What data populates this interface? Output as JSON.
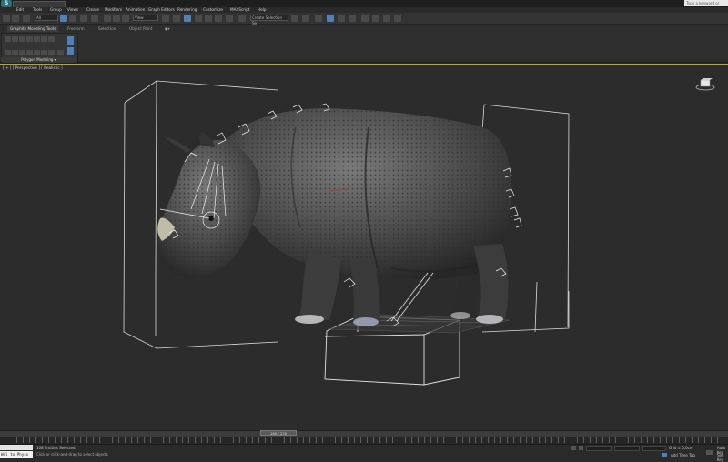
{
  "titlebar": {
    "logo": "S",
    "search_placeholder": "Type a keyword or phrase"
  },
  "menu": {
    "items": [
      "Edit",
      "Tools",
      "Group",
      "Views",
      "Create",
      "Modifiers",
      "Animation",
      "Graph Editors",
      "Rendering",
      "Customize",
      "MAXScript",
      "Help"
    ]
  },
  "toolbar": {
    "undo_count": "All",
    "selection_set_placeholder": "Create Selection Se",
    "view_field": "View"
  },
  "ribbon": {
    "tabs": [
      "Graphite Modeling Tools",
      "Freeform",
      "Selection",
      "Object Paint"
    ],
    "group_label": "Polygon Modeling ▾"
  },
  "viewport": {
    "label": "[ + ] [ Perspective ] [ Realistic ]"
  },
  "timeline": {
    "slider_text": "160 / 270"
  },
  "status": {
    "maxscript_text": "Wel to Physx",
    "selection_text": "108 Entities Selected",
    "prompt_text": "Click or click-and-drag to select objects",
    "grid_text": "Grid = 0,0cm",
    "auto_key": "Auto Key",
    "add_time_tag": "Add Time Tag",
    "set_key": "Set Key"
  },
  "colors": {
    "viewport_border": "#b5a540",
    "highlight_blue": "#4f80b8"
  }
}
